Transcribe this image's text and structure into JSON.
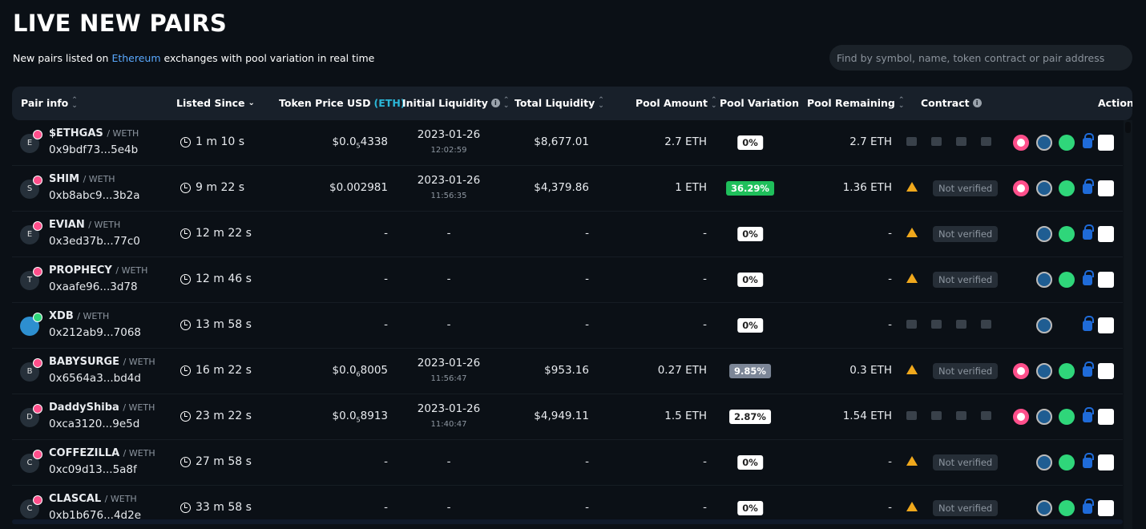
{
  "header": {
    "title": "LIVE NEW PAIRS",
    "subtitle_pre": "New pairs listed on ",
    "subtitle_link": "Ethereum",
    "subtitle_post": " exchanges with pool variation in real time",
    "search_placeholder": "Find by symbol, name, token contract or pair address"
  },
  "columns": {
    "pair_info": "Pair info",
    "listed_since": "Listed Since",
    "token_price": "Token Price USD",
    "token_price_unit": "(ETH)",
    "initial_liquidity": "Initial Liquidity",
    "total_liquidity": "Total Liquidity",
    "pool_amount": "Pool Amount",
    "pool_variation": "Pool Variation",
    "pool_remaining": "Pool Remaining",
    "contract": "Contract",
    "actions": "Actions"
  },
  "colors": {
    "accent_link": "#5aa9ff",
    "eth": "#2bb7d8",
    "green_badge": "#1fbf5b",
    "warning": "#f0a81c"
  },
  "rows": [
    {
      "initial": "E",
      "symbol": "$ETHGAS",
      "quote": "/ WETH",
      "address": "0x9bdf73...5e4b",
      "since": "1 m 10 s",
      "price_pre": "$0.0",
      "price_sub": "5",
      "price_post": "4338",
      "il_date": "2023-01-26",
      "il_time": "12:02:59",
      "total_liq": "$8,677.01",
      "pool_amount": "2.7 ETH",
      "pool_variation": "0%",
      "variation_style": "white",
      "pool_remaining": "2.7 ETH",
      "contract": "icons",
      "actions": [
        "uniswap",
        "chart",
        "green-dex",
        "lock",
        "analytics"
      ]
    },
    {
      "initial": "S",
      "symbol": "SHIM",
      "quote": "/ WETH",
      "address": "0xb8abc9...3b2a",
      "since": "9 m 22 s",
      "price_pre": "$0.002981",
      "price_sub": "",
      "price_post": "",
      "il_date": "2023-01-26",
      "il_time": "11:56:35",
      "total_liq": "$4,379.86",
      "pool_amount": "1 ETH",
      "pool_variation": "36.29%",
      "variation_style": "green",
      "pool_remaining": "1.36 ETH",
      "contract": "Not verified",
      "actions": [
        "uniswap",
        "chart",
        "green-dex",
        "lock",
        "analytics"
      ]
    },
    {
      "initial": "E",
      "symbol": "EVIAN",
      "quote": "/ WETH",
      "address": "0x3ed37b...77c0",
      "since": "12 m 22 s",
      "price_pre": "-",
      "price_sub": "",
      "price_post": "",
      "il_date": "-",
      "il_time": "",
      "total_liq": "-",
      "pool_amount": "-",
      "pool_variation": "0%",
      "variation_style": "white",
      "pool_remaining": "-",
      "contract": "Not verified",
      "actions": [
        "chart",
        "green-dex",
        "lock",
        "analytics"
      ]
    },
    {
      "initial": "T",
      "symbol": "PROPHECY",
      "quote": "/ WETH",
      "address": "0xaafe96...3d78",
      "since": "12 m 46 s",
      "price_pre": "-",
      "price_sub": "",
      "price_post": "",
      "il_date": "-",
      "il_time": "",
      "total_liq": "-",
      "pool_amount": "-",
      "pool_variation": "0%",
      "variation_style": "white",
      "pool_remaining": "-",
      "contract": "Not verified",
      "actions": [
        "chart",
        "green-dex",
        "lock",
        "analytics"
      ]
    },
    {
      "initial": "",
      "symbol": "XDB",
      "quote": "/ WETH",
      "address": "0x212ab9...7068",
      "since": "13 m 58 s",
      "price_pre": "-",
      "price_sub": "",
      "price_post": "",
      "il_date": "-",
      "il_time": "",
      "total_liq": "-",
      "pool_amount": "-",
      "pool_variation": "0%",
      "variation_style": "white",
      "pool_remaining": "-",
      "contract": "icons",
      "actions": [
        "chart",
        "lock",
        "analytics"
      ]
    },
    {
      "initial": "B",
      "symbol": "BABYSURGE",
      "quote": "/ WETH",
      "address": "0x6564a3...bd4d",
      "since": "16 m 22 s",
      "price_pre": "$0.0",
      "price_sub": "6",
      "price_post": "8005",
      "il_date": "2023-01-26",
      "il_time": "11:56:47",
      "total_liq": "$953.16",
      "pool_amount": "0.27 ETH",
      "pool_variation": "9.85%",
      "variation_style": "grey",
      "pool_remaining": "0.3 ETH",
      "contract": "Not verified",
      "actions": [
        "uniswap",
        "chart",
        "green-dex",
        "lock",
        "analytics"
      ]
    },
    {
      "initial": "D",
      "symbol": "DaddyShiba",
      "quote": "/ WETH",
      "address": "0xca3120...9e5d",
      "since": "23 m 22 s",
      "price_pre": "$0.0",
      "price_sub": "5",
      "price_post": "8913",
      "il_date": "2023-01-26",
      "il_time": "11:40:47",
      "total_liq": "$4,949.11",
      "pool_amount": "1.5 ETH",
      "pool_variation": "2.87%",
      "variation_style": "white",
      "pool_remaining": "1.54 ETH",
      "contract": "icons",
      "actions": [
        "uniswap",
        "chart",
        "green-dex",
        "lock",
        "analytics"
      ]
    },
    {
      "initial": "C",
      "symbol": "COFFEZILLA",
      "quote": "/ WETH",
      "address": "0xc09d13...5a8f",
      "since": "27 m 58 s",
      "price_pre": "-",
      "price_sub": "",
      "price_post": "",
      "il_date": "-",
      "il_time": "",
      "total_liq": "-",
      "pool_amount": "-",
      "pool_variation": "0%",
      "variation_style": "white",
      "pool_remaining": "-",
      "contract": "Not verified",
      "actions": [
        "chart",
        "green-dex",
        "lock",
        "analytics"
      ]
    },
    {
      "initial": "C",
      "symbol": "CLASCAL",
      "quote": "/ WETH",
      "address": "0xb1b676...4d2e",
      "since": "33 m 58 s",
      "price_pre": "-",
      "price_sub": "",
      "price_post": "",
      "il_date": "-",
      "il_time": "",
      "total_liq": "-",
      "pool_amount": "-",
      "pool_variation": "0%",
      "variation_style": "white",
      "pool_remaining": "-",
      "contract": "Not verified",
      "actions": [
        "chart",
        "green-dex",
        "lock",
        "analytics"
      ]
    }
  ]
}
